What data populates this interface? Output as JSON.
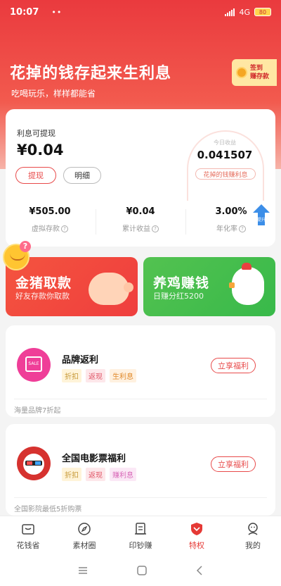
{
  "status_bar": {
    "time": "10:07",
    "dots": "••",
    "network": "4G",
    "battery": "80"
  },
  "hero": {
    "title": "花掉的钱存起来生利息",
    "subtitle": "吃喝玩乐，样样都能省"
  },
  "signin": {
    "line1": "签到",
    "line2": "赚存款"
  },
  "summary": {
    "withdrawable_label": "利息可提现",
    "withdrawable_amount": "¥0.04",
    "withdraw_button": "提现",
    "detail_button": "明细",
    "today_label": "今日收益",
    "today_value": "0.041507",
    "today_tag": "花掉的钱赚利息",
    "stats": [
      {
        "value": "¥505.00",
        "label": "虚拟存款"
      },
      {
        "value": "¥0.04",
        "label": "累计收益"
      },
      {
        "value": "3.00%",
        "label": "年化率"
      }
    ],
    "help_glyph": "?",
    "up_badge": "提升"
  },
  "promos": [
    {
      "title": "金猪取款",
      "subtitle": "好友存款你取款",
      "color": "#f04a3e"
    },
    {
      "title": "养鸡赚钱",
      "subtitle": "日赚分红5200",
      "color": "#4cbd4c"
    }
  ],
  "mascot": {
    "badge": "?"
  },
  "offers": [
    {
      "title": "品牌返利",
      "tags": [
        "折扣",
        "返现",
        "生利息"
      ],
      "button": "立享福利",
      "footer": "海量品牌7折起",
      "logo_text": "SALE"
    },
    {
      "title": "全国电影票福利",
      "tags": [
        "折扣",
        "返现",
        "赚利息"
      ],
      "button": "立享福利",
      "footer": "全国影院最低5折购票"
    }
  ],
  "tabbar": [
    {
      "label": "花钱省",
      "icon": "wallet-icon"
    },
    {
      "label": "素材圈",
      "icon": "compass-icon"
    },
    {
      "label": "印钞赚",
      "icon": "printer-icon"
    },
    {
      "label": "特权",
      "icon": "shield-icon",
      "active": true
    },
    {
      "label": "我的",
      "icon": "user-icon"
    }
  ],
  "system_nav": {
    "menu": "≡",
    "home": "□",
    "back": "‹"
  },
  "colors": {
    "primary": "#e53935",
    "header_top": "#ea3a3e",
    "green": "#4cbd4c"
  }
}
